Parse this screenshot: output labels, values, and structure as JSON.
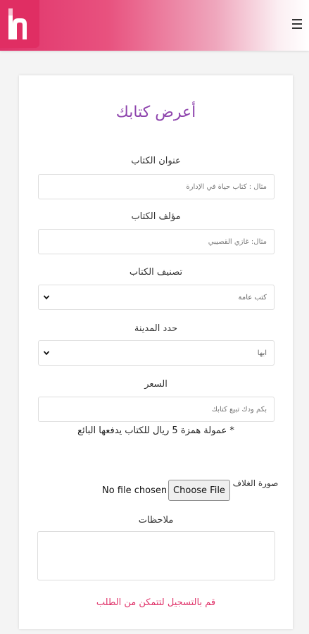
{
  "header": {
    "logo_letter": "h",
    "menu_icon": "hamburger-menu-icon",
    "accent_color": "#e0336a"
  },
  "form": {
    "title": "أعرض كتابك",
    "book_title": {
      "label": "عنوان الكتاب",
      "placeholder": "مثال : كتاب حياة في الإدارة"
    },
    "author": {
      "label": "مؤلف الكتاب",
      "placeholder": "مثال: غازي القصيبي"
    },
    "category": {
      "label": "تصنيف الكتاب",
      "selected": "كتب عامة"
    },
    "city": {
      "label": "حدد المدينة",
      "selected": "ابها"
    },
    "price": {
      "label": "السعر",
      "placeholder": "بكم ودك تبيع كتابك"
    },
    "commission_note": "* عمولة همزة 5 ريال للكتاب يدفعها البائع",
    "cover": {
      "label": "صورة الغلاف",
      "button_label": "Choose File",
      "status": "No file chosen"
    },
    "notes": {
      "label": "ملاحظات"
    },
    "register_link": "قم بالتسجيل لتتمكن من الطلب",
    "title_color": "#8e44ad"
  }
}
